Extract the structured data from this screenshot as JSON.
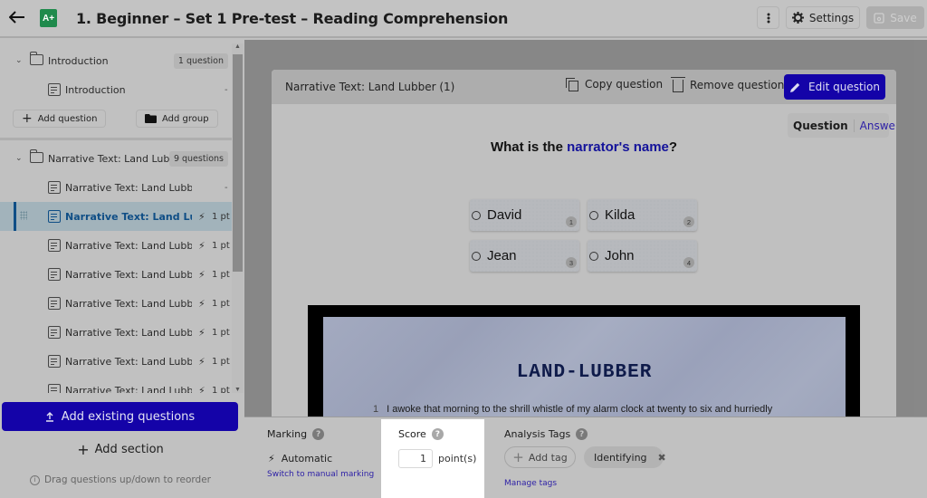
{
  "header": {
    "title": "1. Beginner – Set 1 Pre-test – Reading Comprehension",
    "logo_text": "A+",
    "settings_label": "Settings",
    "save_label": "Save"
  },
  "sidebar": {
    "groups": [
      {
        "label": "Introduction",
        "count": "1 question",
        "questions": [
          {
            "label": "Introduction",
            "marking": "",
            "points": "-"
          }
        ],
        "add_question_label": "Add question",
        "add_group_label": "Add group"
      },
      {
        "label": "Narrative Text: Land Lubber",
        "count": "9 questions",
        "questions": [
          {
            "label": "Narrative Text: Land Lubber",
            "points": "-"
          },
          {
            "label": "Narrative Text: Land Lubb...",
            "points": "1 pt",
            "active": true
          },
          {
            "label": "Narrative Text: Land Lubber...",
            "points": "1 pt"
          },
          {
            "label": "Narrative Text: Land Lubber...",
            "points": "1 pt"
          },
          {
            "label": "Narrative Text: Land Lubber...",
            "points": "1 pt"
          },
          {
            "label": "Narrative Text: Land Lubber...",
            "points": "1 pt"
          },
          {
            "label": "Narrative Text: Land Lubber...",
            "points": "1 pt"
          },
          {
            "label": "Narrative Text: Land Lubber...",
            "points": "1 pt"
          }
        ]
      }
    ],
    "add_existing_label": "Add existing questions",
    "add_section_label": "Add section",
    "drag_hint": "Drag questions up/down to reorder"
  },
  "question_card": {
    "title": "Narrative Text: Land Lubber (1)",
    "copy_label": "Copy question",
    "remove_label": "Remove question",
    "edit_label": "Edit question",
    "view_toggle": {
      "question": "Question",
      "answer": "Answer",
      "selected": "Question"
    },
    "prompt": {
      "before": "What is the ",
      "highlight": "narrator's name",
      "after": "?"
    },
    "options": [
      {
        "label": "David",
        "num": "1"
      },
      {
        "label": "Kilda",
        "num": "2"
      },
      {
        "label": "Jean",
        "num": "3"
      },
      {
        "label": "John",
        "num": "4"
      }
    ],
    "passage": {
      "title": "LAND-LUBBER",
      "line_number": "1",
      "line_text": "I awoke that morning to the shrill whistle of my alarm clock at twenty to six and hurriedly"
    }
  },
  "bottom_panel": {
    "marking": {
      "title": "Marking",
      "mode": "Automatic",
      "switch_link": "Switch to manual marking"
    },
    "score": {
      "title": "Score",
      "value": "1",
      "unit": "point(s)"
    },
    "tags": {
      "title": "Analysis Tags",
      "add_label": "Add tag",
      "items": [
        "Identifying"
      ],
      "manage_link": "Manage tags"
    }
  },
  "colors": {
    "primary": "#1403a8",
    "link": "#2c1fa6",
    "active_item": "#0f4e86",
    "logo": "#1f8a4c",
    "highlight_text": "#13129a"
  }
}
